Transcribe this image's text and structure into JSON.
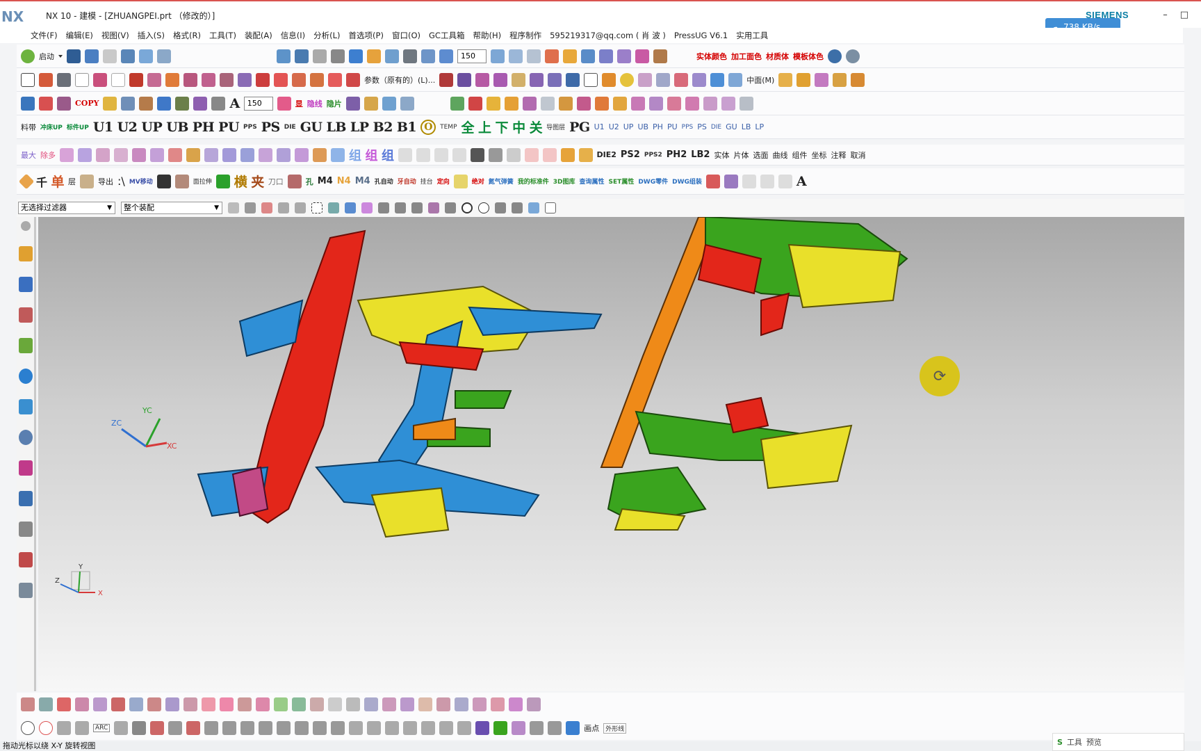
{
  "window": {
    "logo": "NX",
    "title": "NX 10 - 建模 - [ZHUANGPEI.prt （修改的）]",
    "brand": "SIEMENS",
    "speed_badge": "738 KB/s",
    "minimize": "–",
    "maximize": "□"
  },
  "menu": {
    "items": [
      "文件(F)",
      "编辑(E)",
      "视图(V)",
      "插入(S)",
      "格式(R)",
      "工具(T)",
      "装配(A)",
      "信息(I)",
      "分析(L)",
      "首选项(P)",
      "窗口(O)",
      "GC工具箱",
      "帮助(H)",
      "程序制作",
      "595219317@qq.com ( 肖 波 )",
      "PressUG V6.1",
      "实用工具"
    ]
  },
  "toolbar_row1": {
    "start_label": "启动",
    "zoom_value": "150",
    "right_labels": [
      "实体颜色",
      "加工面色",
      "材质体",
      "模板体色"
    ]
  },
  "toolbar_row2": {
    "param_label": "参数（原有的）(L)...",
    "mid_label": "中面(M)"
  },
  "toolbar_row3": {
    "copy_label": "COPY",
    "font_value": "150",
    "labels": [
      "显",
      "隐线",
      "隐片"
    ]
  },
  "toolbar_row4": {
    "labels": [
      "料带",
      "冲床UP",
      "标件UP",
      "U1",
      "U2",
      "UP",
      "UB",
      "PH",
      "PU",
      "PPS",
      "PS",
      "DIE",
      "GU",
      "LB",
      "LP",
      "B2",
      "B1",
      "O",
      "TEMP",
      "全",
      "上",
      "下",
      "中",
      "关",
      "导图层",
      "PG",
      "U1",
      "U2",
      "UP",
      "UB",
      "PH",
      "PU",
      "PPS",
      "PS",
      "DIE",
      "GU",
      "LB",
      "LP"
    ]
  },
  "toolbar_row5": {
    "labels": [
      "最大",
      "除多",
      "组",
      "组",
      "组",
      "DIE2",
      "PS2",
      "PPS2",
      "PH2",
      "LB2",
      "实体",
      "片体",
      "选面",
      "曲线",
      "组件",
      "坐标",
      "注释",
      "取消"
    ]
  },
  "toolbar_row6": {
    "labels": [
      "千",
      "单",
      "层",
      "导出",
      "MV移动",
      "面拉伸",
      "横",
      "夹",
      "刀口",
      "孔",
      "M4",
      "N4",
      "M4",
      "孔自动",
      "牙自动",
      "挂台",
      "定向",
      "绝对",
      "氮气弹簧",
      "我的标准件",
      "3D图库",
      "查询属性",
      "SET属性",
      "DWG零件",
      "DWG组装",
      "A"
    ]
  },
  "filterbar": {
    "filter_select": "无选择过滤器",
    "scope_select": "整个装配"
  },
  "viewport": {
    "wcs_labels": [
      "YC",
      "ZC",
      "XC"
    ],
    "abs_labels": [
      "Y",
      "Z",
      "X"
    ]
  },
  "bottom_row2": {
    "arc_label": "ARC",
    "point_label": "画点",
    "ext_label": "外形线"
  },
  "status": {
    "text": "拖动光标以绕 X-Y 旋转视图",
    "tray_labels": [
      "工具",
      "预览"
    ]
  },
  "colors": {
    "red_part": "#e3261a",
    "blue_part": "#2f8fd6",
    "yellow_part": "#e9e02a",
    "green_part": "#3aa41e",
    "orange_part": "#ef8a18"
  }
}
